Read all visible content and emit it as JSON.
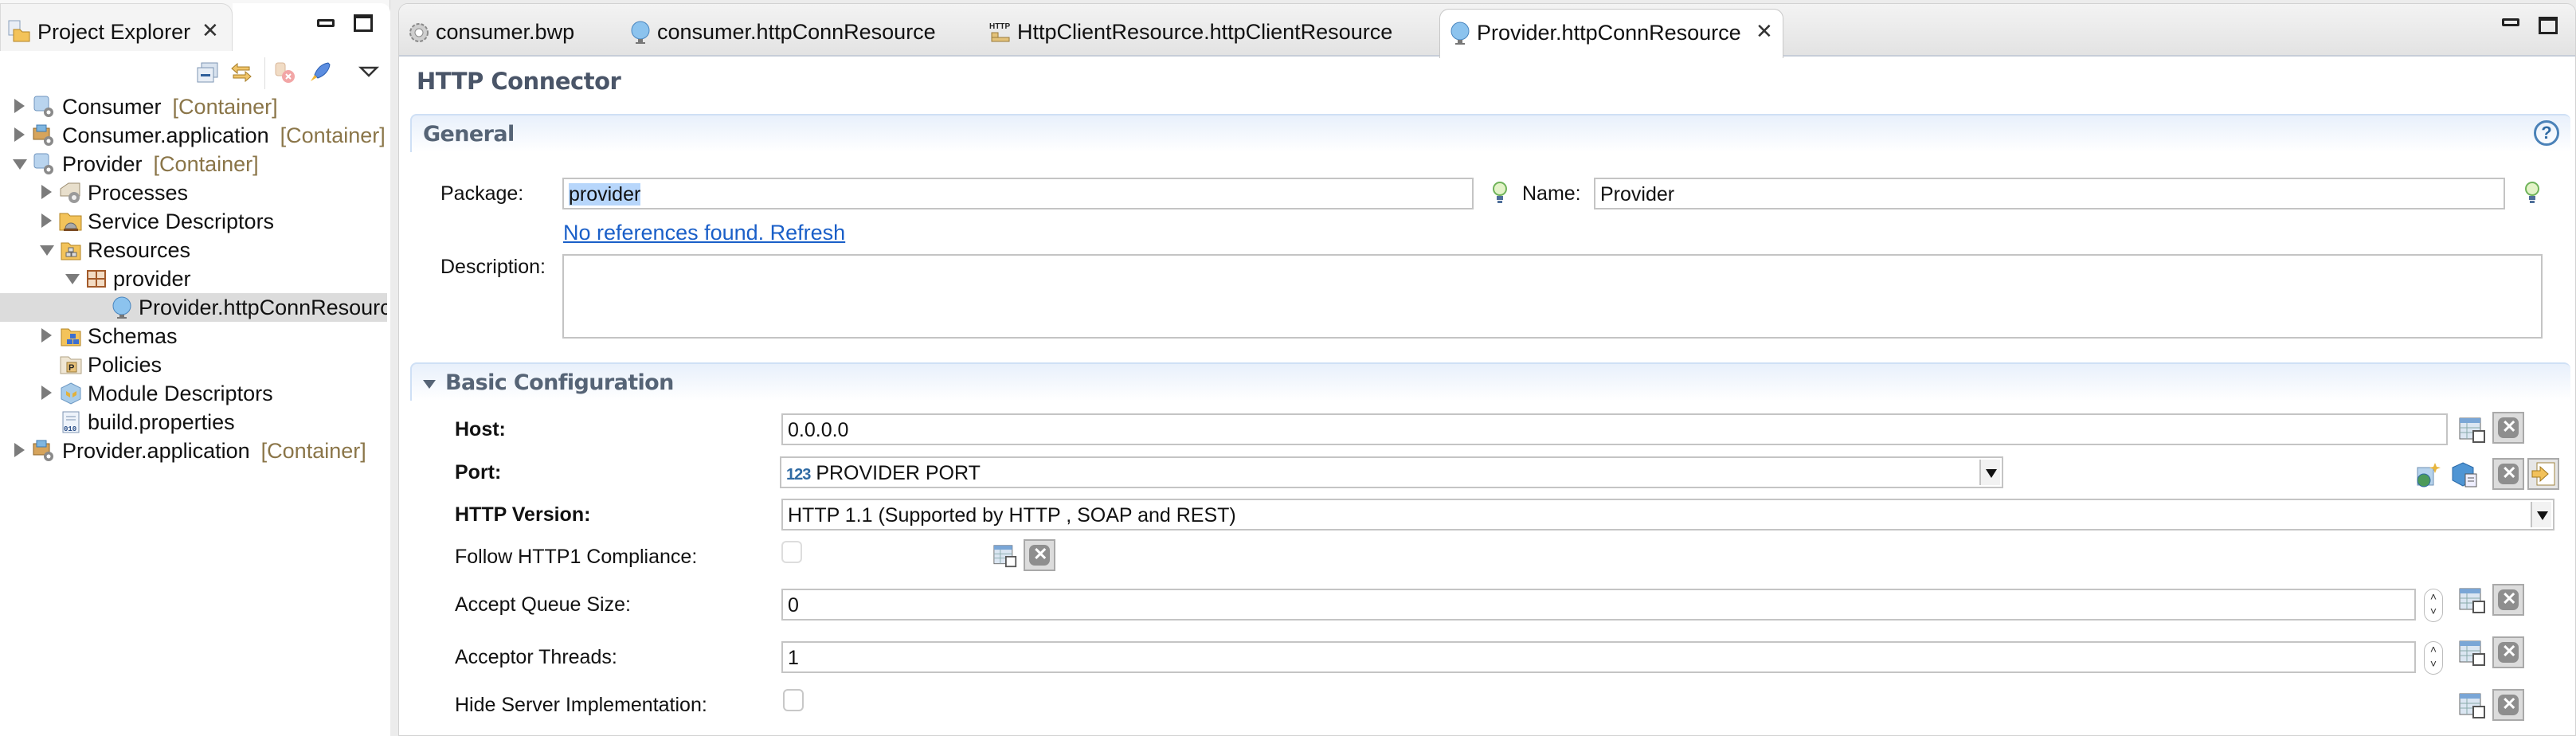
{
  "sidebar": {
    "tab_label": "Project Explorer",
    "tree": [
      {
        "label": "Consumer",
        "decoration": "[Container]",
        "level": 0,
        "expanded": false,
        "icon": "container-project-icon"
      },
      {
        "label": "Consumer.application",
        "decoration": "[Container]",
        "level": 0,
        "expanded": false,
        "icon": "application-project-icon"
      },
      {
        "label": "Provider",
        "decoration": "[Container]",
        "level": 0,
        "expanded": true,
        "icon": "container-project-icon"
      },
      {
        "label": "Processes",
        "decoration": "",
        "level": 1,
        "expanded": false,
        "icon": "processes-folder-icon"
      },
      {
        "label": "Service Descriptors",
        "decoration": "",
        "level": 1,
        "expanded": false,
        "icon": "service-descriptors-folder-icon"
      },
      {
        "label": "Resources",
        "decoration": "",
        "level": 1,
        "expanded": true,
        "icon": "resources-folder-icon"
      },
      {
        "label": "provider",
        "decoration": "",
        "level": 2,
        "expanded": true,
        "icon": "package-icon"
      },
      {
        "label": "Provider.httpConnResource",
        "decoration": "",
        "level": 3,
        "expanded": null,
        "icon": "http-connector-resource-icon",
        "selected": true
      },
      {
        "label": "Schemas",
        "decoration": "",
        "level": 1,
        "expanded": false,
        "icon": "schemas-folder-icon"
      },
      {
        "label": "Policies",
        "decoration": "",
        "level": 1,
        "expanded": null,
        "icon": "policies-folder-icon"
      },
      {
        "label": "Module Descriptors",
        "decoration": "",
        "level": 1,
        "expanded": false,
        "icon": "module-descriptors-icon"
      },
      {
        "label": "build.properties",
        "decoration": "",
        "level": 1,
        "expanded": null,
        "icon": "properties-file-icon"
      },
      {
        "label": "Provider.application",
        "decoration": "[Container]",
        "level": 0,
        "expanded": false,
        "icon": "application-project-icon"
      }
    ]
  },
  "editor": {
    "tabs": [
      {
        "label": "consumer.bwp",
        "icon": "process-gear-icon",
        "active": false
      },
      {
        "label": "consumer.httpConnResource",
        "icon": "globe-icon",
        "active": false
      },
      {
        "label": "HttpClientResource.httpClientResource",
        "icon": "http-client-icon",
        "active": false
      },
      {
        "label": "Provider.httpConnResource",
        "icon": "globe-icon",
        "active": true
      }
    ],
    "title": "HTTP Connector",
    "general": {
      "title": "General",
      "package_label": "Package:",
      "package_value": "provider",
      "name_label": "Name:",
      "name_value": "Provider",
      "references_link": "No references found. Refresh",
      "description_label": "Description:",
      "description_value": ""
    },
    "basic": {
      "title": "Basic Configuration",
      "host_label": "Host:",
      "host_value": "0.0.0.0",
      "port_label": "Port:",
      "port_value": "PROVIDER PORT",
      "port_prefix_icon": "123",
      "http_version_label": "HTTP Version:",
      "http_version_value": "HTTP 1.1 (Supported by HTTP , SOAP and REST)",
      "follow_label": "Follow HTTP1 Compliance:",
      "follow_checked": false,
      "accept_queue_label": "Accept Queue Size:",
      "accept_queue_value": "0",
      "acceptor_threads_label": "Acceptor Threads:",
      "acceptor_threads_value": "1",
      "hide_server_label": "Hide Server Implementation:",
      "hide_server_checked": false
    },
    "help_glyph": "?",
    "spinner_glyph_up": "˄",
    "spinner_glyph_down": "˅"
  }
}
